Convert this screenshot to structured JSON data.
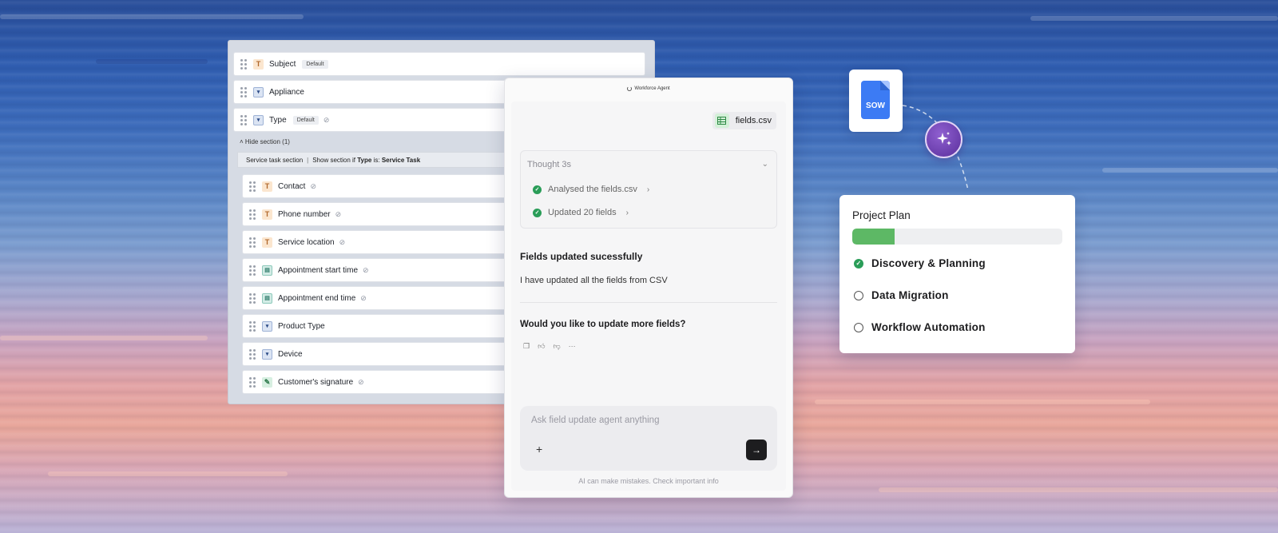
{
  "form_editor": {
    "fields": [
      {
        "label": "Subject",
        "icon": "text-type-icon",
        "tag": "Default",
        "hidden_icon": false
      },
      {
        "label": "Appliance",
        "icon": "dropdown-type-icon",
        "tag": "",
        "hidden_icon": false
      },
      {
        "label": "Type",
        "icon": "dropdown-type-icon",
        "tag": "Default",
        "hidden_icon": true
      }
    ],
    "hide_section_label": "Hide section (1)",
    "section": {
      "name": "Service task section",
      "rule_prefix": "Show section if",
      "rule_field": "Type",
      "rule_mid": "is:",
      "rule_value": "Service Task"
    },
    "section_fields": [
      {
        "label": "Contact",
        "icon": "text-type-icon"
      },
      {
        "label": "Phone number",
        "icon": "text-type-icon"
      },
      {
        "label": "Service location",
        "icon": "text-type-icon"
      },
      {
        "label": "Appointment start time",
        "icon": "datetime-type-icon"
      },
      {
        "label": "Appointment end time",
        "icon": "datetime-type-icon"
      },
      {
        "label": "Product Type",
        "icon": "dropdown-type-icon"
      },
      {
        "label": "Device",
        "icon": "dropdown-type-icon"
      },
      {
        "label": "Customer's signature",
        "icon": "signature-type-icon"
      }
    ]
  },
  "chat": {
    "title": "Workforce Agent",
    "file_name": "fields.csv",
    "thought_label": "Thought 3s",
    "steps": [
      "Analysed the fields.csv",
      "Updated 20 fields"
    ],
    "response_title": "Fields updated sucessfully",
    "response_body": "I have updated all the fields from CSV",
    "question": "Would you like to update more fields?",
    "input_placeholder": "Ask field update agent anything",
    "disclaimer": "AI can make mistakes. Check important info"
  },
  "sow": {
    "label": "SOW"
  },
  "plan": {
    "title": "Project Plan",
    "progress": 0.2,
    "progress_color": "#5db865",
    "items": [
      {
        "label": "Discovery & Planning",
        "done": true
      },
      {
        "label": "Data Migration",
        "done": false
      },
      {
        "label": "Workflow Automation",
        "done": false
      }
    ]
  },
  "colors": {
    "accent_green": "#2a9d58",
    "sparkle_purple": "#6b3db0",
    "sow_blue": "#3c7bf4"
  }
}
